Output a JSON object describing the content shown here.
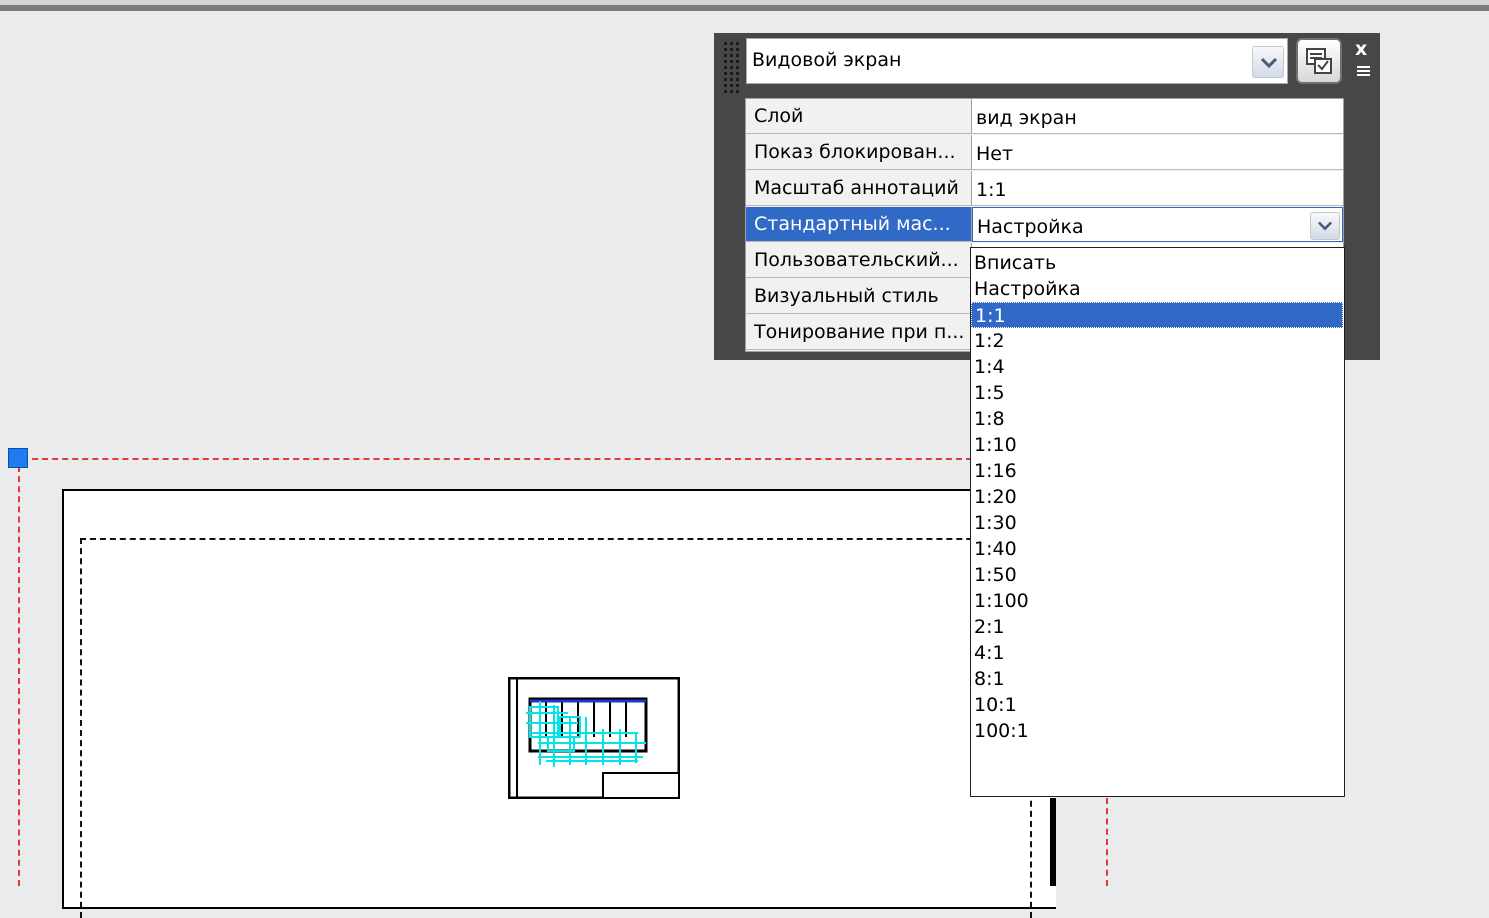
{
  "palette": {
    "object_type": "Видовой экран",
    "properties": [
      {
        "label": "Слой",
        "value": "вид экран"
      },
      {
        "label": "Показ блокирован...",
        "value": "Нет"
      },
      {
        "label": "Масштаб аннотаций",
        "value": "1:1"
      },
      {
        "label": "Стандартный мас...",
        "value": "Настройка",
        "selected": true
      },
      {
        "label": "Пользовательский...",
        "value": ""
      },
      {
        "label": "Визуальный стиль",
        "value": ""
      },
      {
        "label": "Тонирование при п...",
        "value": ""
      }
    ],
    "close_glyph": "x"
  },
  "scale_list": {
    "options": [
      "Вписать",
      "Настройка",
      "1:1",
      "1:2",
      "1:4",
      "1:5",
      "1:8",
      "1:10",
      "1:16",
      "1:20",
      "1:30",
      "1:40",
      "1:50",
      "1:100",
      "2:1",
      "4:1",
      "8:1",
      "10:1",
      "100:1"
    ],
    "highlighted": "1:1"
  },
  "colors": {
    "selection_blue": "#3169c6",
    "palette_bg": "#474747",
    "selection_dashes": "#e23a3a",
    "grip_blue": "#1e7cf0",
    "geometry_cyan": "#00e5e5"
  },
  "icons": [
    "grab-handle-icon",
    "chevron-down-icon",
    "quick-select-icon",
    "close-icon",
    "palette-menu-icon",
    "grip-icon"
  ]
}
